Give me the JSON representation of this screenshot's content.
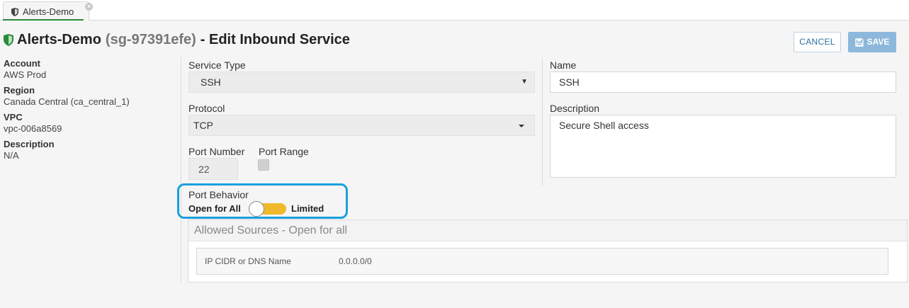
{
  "tab": {
    "label": "Alerts-Demo",
    "close": "×"
  },
  "header": {
    "title": "Alerts-Demo",
    "sg_id": "(sg-97391efe)",
    "suffix": "- Edit Inbound Service",
    "cancel_label": "CANCEL",
    "save_label": "SAVE"
  },
  "info": [
    {
      "label": "Account",
      "value": "AWS Prod"
    },
    {
      "label": "Region",
      "value": "Canada Central (ca_central_1)"
    },
    {
      "label": "VPC",
      "value": "vpc-006a8569"
    },
    {
      "label": "Description",
      "value": "N/A"
    }
  ],
  "form": {
    "service_type": {
      "label": "Service Type",
      "value": "SSH",
      "caret": "▼"
    },
    "protocol": {
      "label": "Protocol",
      "value": "TCP"
    },
    "port_number": {
      "label": "Port Number",
      "value": "22"
    },
    "port_range": {
      "label": "Port Range",
      "checked": false
    },
    "port_behavior": {
      "label": "Port Behavior",
      "left_option": "Open for All",
      "right_option": "Limited",
      "selected": "Open for All"
    },
    "name": {
      "label": "Name",
      "value": "SSH"
    },
    "description": {
      "label": "Description",
      "value": "Secure Shell access"
    }
  },
  "allowed_sources": {
    "title": "Allowed Sources - Open for all",
    "row_label": "IP CIDR or DNS Name",
    "row_value": "0.0.0.0/0"
  },
  "colors": {
    "accent_blue": "#2b6f9e",
    "save_blue": "#8db8dc",
    "toggle_yellow": "#efb92a",
    "highlight_cyan": "#1aa0dc",
    "shield_green": "#2a8a3a"
  },
  "icons": {
    "tab": "shield-icon",
    "title": "green-shield-icon",
    "save": "floppy-disk-icon"
  }
}
